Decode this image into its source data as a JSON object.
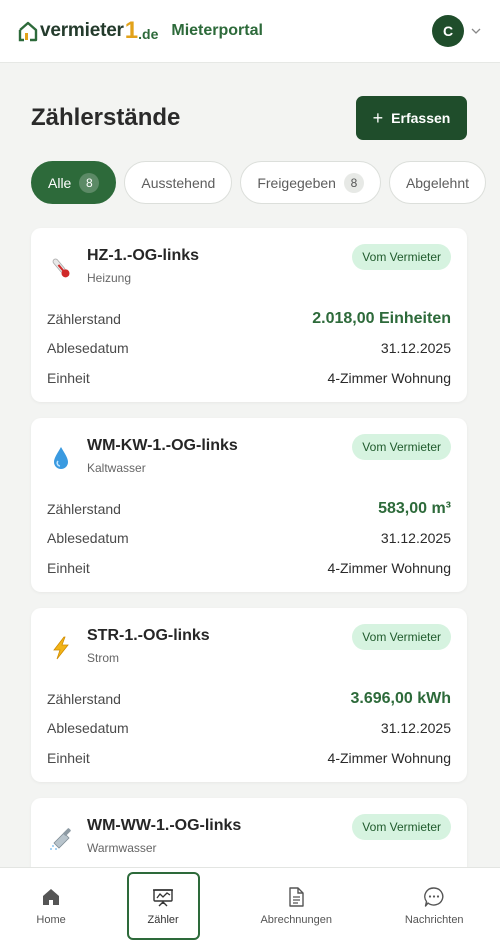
{
  "header": {
    "logo_text": "vermieter",
    "logo_one": "1",
    "logo_tld": ".de",
    "portal_title": "Mieterportal",
    "avatar_initial": "C"
  },
  "page": {
    "title": "Zählerstände",
    "add_button_label": "Erfassen"
  },
  "filters": [
    {
      "label": "Alle",
      "count": "8",
      "active": true
    },
    {
      "label": "Ausstehend",
      "count": null,
      "active": false
    },
    {
      "label": "Freigegeben",
      "count": "8",
      "active": false
    },
    {
      "label": "Abgelehnt",
      "count": null,
      "active": false
    }
  ],
  "labels": {
    "reading": "Zählerstand",
    "date": "Ablesedatum",
    "unit": "Einheit"
  },
  "meters": [
    {
      "name": "HZ-1.-OG-links",
      "type": "Heizung",
      "badge": "Vom Vermieter",
      "reading": "2.018,00 Einheiten",
      "date": "31.12.2025",
      "unit": "4-Zimmer Wohnung",
      "icon": "thermometer-icon"
    },
    {
      "name": "WM-KW-1.-OG-links",
      "type": "Kaltwasser",
      "badge": "Vom Vermieter",
      "reading": "583,00 m³",
      "date": "31.12.2025",
      "unit": "4-Zimmer Wohnung",
      "icon": "water-drop-icon"
    },
    {
      "name": "STR-1.-OG-links",
      "type": "Strom",
      "badge": "Vom Vermieter",
      "reading": "3.696,00 kWh",
      "date": "31.12.2025",
      "unit": "4-Zimmer Wohnung",
      "icon": "lightning-icon"
    },
    {
      "name": "WM-WW-1.-OG-links",
      "type": "Warmwasser",
      "badge": "Vom Vermieter",
      "icon": "shower-icon"
    }
  ],
  "nav": [
    {
      "label": "Home",
      "icon": "home-icon",
      "active": false
    },
    {
      "label": "Zähler",
      "icon": "meter-icon",
      "active": true
    },
    {
      "label": "Abrechnungen",
      "icon": "document-icon",
      "active": false
    },
    {
      "label": "Nachrichten",
      "icon": "chat-icon",
      "active": false
    }
  ],
  "colors": {
    "brand_green": "#2d6a3a",
    "dark_green": "#1f4d2b",
    "badge_bg": "#d6f3e0",
    "logo_accent": "#e2a21a"
  }
}
